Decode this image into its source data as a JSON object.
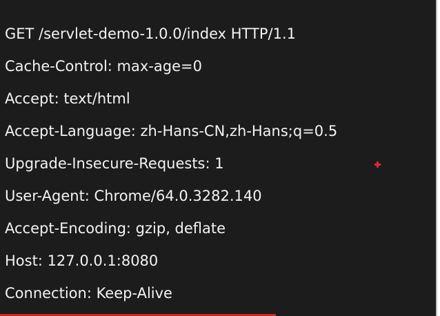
{
  "http_request": {
    "lines": [
      "GET /servlet-demo-1.0.0/index HTTP/1.1",
      "Cache-Control: max-age=0",
      "Accept: text/html",
      "Accept-Language: zh-Hans-CN,zh-Hans;q=0.5",
      "Upgrade-Insecure-Requests: 1",
      "User-Agent: Chrome/64.0.3282.140",
      "Accept-Encoding: gzip, deflate",
      "Host: 127.0.0.1:8080",
      "Connection: Keep-Alive"
    ]
  },
  "colors": {
    "background": "#1c1c1c",
    "text": "#f3f3f3",
    "cursor_marker": "#e0243a",
    "bottom_bar": "#c62828"
  }
}
